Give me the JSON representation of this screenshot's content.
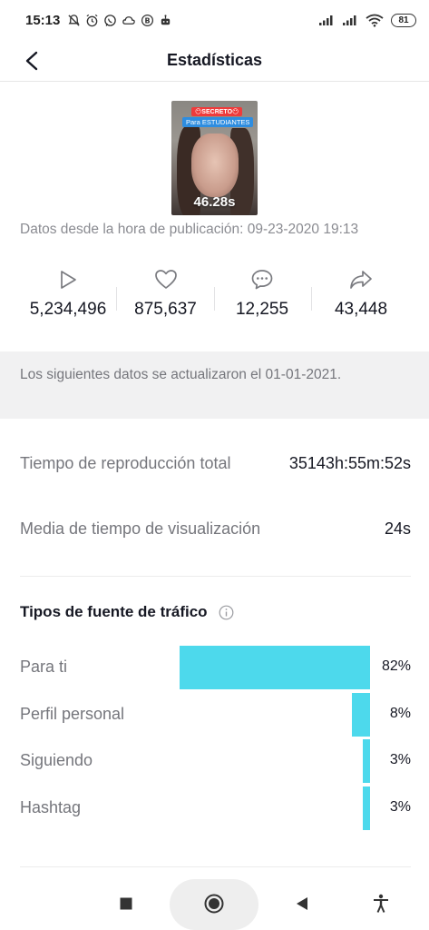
{
  "status_bar": {
    "time": "15:13",
    "battery": "81"
  },
  "header": {
    "title": "Estadísticas"
  },
  "video": {
    "tag_top": "😶SECRETO😶",
    "tag_bottom": "Para ESTUDIANTES",
    "duration": "46.28s"
  },
  "pub_date": "Datos desde la hora de publicación: 09-23-2020 19:13",
  "metrics": {
    "plays": "5,234,496",
    "likes": "875,637",
    "comments": "12,255",
    "shares": "43,448"
  },
  "notice": "Los siguientes datos se actualizaron el 01-01-2021.",
  "stats": {
    "total_playtime_label": "Tiempo de reproducción total",
    "total_playtime_value": "35143h:55m:52s",
    "avg_watch_label": "Media de tiempo de visualización",
    "avg_watch_value": "24s"
  },
  "traffic": {
    "title": "Tipos de fuente de tráfico",
    "sources": [
      {
        "label": "Para ti",
        "percent": "82%",
        "value": 82
      },
      {
        "label": "Perfil personal",
        "percent": "8%",
        "value": 8
      },
      {
        "label": "Siguiendo",
        "percent": "3%",
        "value": 3
      },
      {
        "label": "Hashtag",
        "percent": "3%",
        "value": 3
      }
    ],
    "bar_color": "#4dd9ec"
  },
  "icons": {
    "back": "chevron-left-icon",
    "plays": "play-icon",
    "likes": "heart-icon",
    "comments": "comment-icon",
    "shares": "share-icon",
    "info": "info-icon"
  }
}
